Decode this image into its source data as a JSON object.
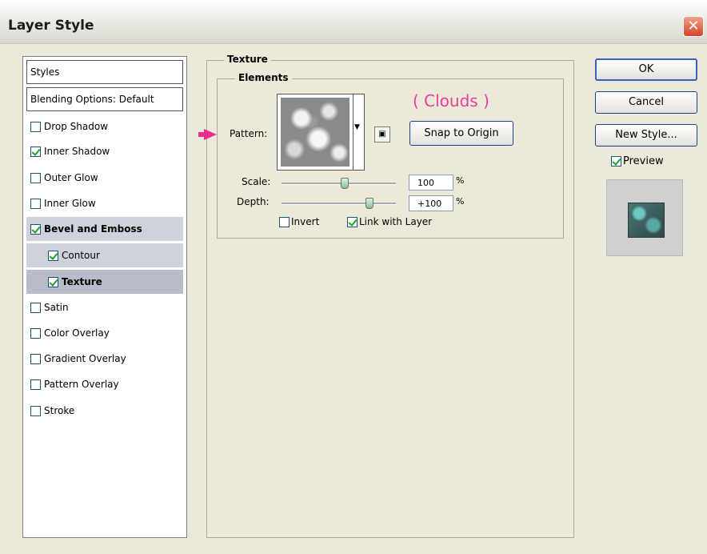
{
  "window": {
    "title": "Layer Style",
    "close_glyph": "✕"
  },
  "styles_list": {
    "header": "Styles",
    "blending": "Blending Options: Default",
    "items": [
      {
        "label": "Drop Shadow",
        "checked": false
      },
      {
        "label": "Inner Shadow",
        "checked": true
      },
      {
        "label": "Outer Glow",
        "checked": false
      },
      {
        "label": "Inner Glow",
        "checked": false
      },
      {
        "label": "Bevel and Emboss",
        "checked": true
      },
      {
        "label": "Contour",
        "checked": true
      },
      {
        "label": "Texture",
        "checked": true
      },
      {
        "label": "Satin",
        "checked": false
      },
      {
        "label": "Color Overlay",
        "checked": false
      },
      {
        "label": "Gradient Overlay",
        "checked": false
      },
      {
        "label": "Pattern Overlay",
        "checked": false
      },
      {
        "label": "Stroke",
        "checked": false
      }
    ]
  },
  "texture": {
    "group_label": "Texture",
    "elements_label": "Elements",
    "pattern_label": "Pattern:",
    "annotation": "( Clouds )",
    "snap_button": "Snap to Origin",
    "scale_label": "Scale:",
    "scale_value": "100",
    "depth_label": "Depth:",
    "depth_value": "+100",
    "percent": "%",
    "invert_label": "Invert",
    "invert_checked": false,
    "link_label": "Link with Layer",
    "link_checked": true,
    "scale_slider_pct": 0.55,
    "depth_slider_pct": 0.77
  },
  "buttons": {
    "ok": "OK",
    "cancel": "Cancel",
    "new_style": "New Style...",
    "preview_label": "Preview",
    "preview_checked": true
  },
  "colors": {
    "annotation_pink": "#e73c9a",
    "arrow_pink": "#ea2e8d",
    "selected_row": "#cfd2da",
    "dialog_bg": "#ece9d8"
  }
}
